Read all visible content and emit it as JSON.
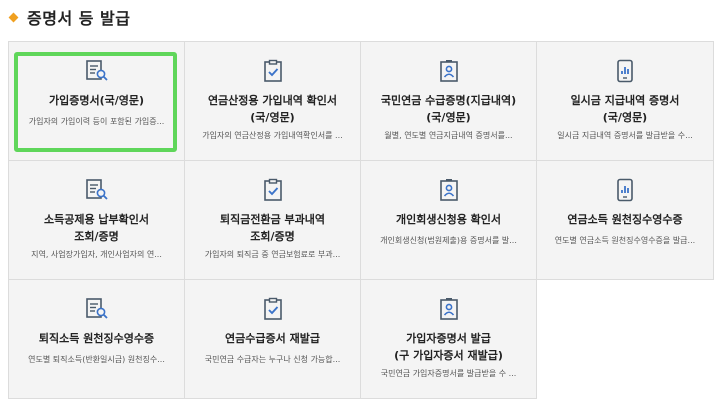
{
  "page": {
    "title": "증명서 등 발급"
  },
  "colors": {
    "accent_diamond": "#f0a020",
    "highlight": "#5fd65a",
    "icon": "#4a5a6a",
    "icon_accent": "#3b73c9"
  },
  "cards": [
    {
      "icon": "document-search-icon",
      "title_lines": [
        "가입증명서(국/영문)"
      ],
      "desc": "가입자의 가입이력 등이 포함된 가입증..."
    },
    {
      "icon": "clipboard-check-icon",
      "title_lines": [
        "연금산정용 가입내역 확인서",
        "(국/영문)"
      ],
      "desc": "가입자의 연금산정용 가입내역확인서를 ..."
    },
    {
      "icon": "id-badge-icon",
      "title_lines": [
        "국민연금 수급증명(지급내역)",
        "(국/영문)"
      ],
      "desc": "월별, 연도별 연금지급내역 증명서를..."
    },
    {
      "icon": "mobile-chart-icon",
      "title_lines": [
        "일시금 지급내역 증명서",
        "(국/영문)"
      ],
      "desc": "일시금 지급내역 증명서를 발급받을 수..."
    },
    {
      "icon": "document-search-icon",
      "title_lines": [
        "소득공제용 납부확인서",
        "조회/증명"
      ],
      "desc": "지역, 사업장가입자, 개인사업자의 연..."
    },
    {
      "icon": "clipboard-check-icon",
      "title_lines": [
        "퇴직금전환금 부과내역",
        "조회/증명"
      ],
      "desc": "가입자의 퇴직금 중 연금보험료로 부과..."
    },
    {
      "icon": "id-badge-icon",
      "title_lines": [
        "개인회생신청용 확인서"
      ],
      "desc": "개인회생신청(법원제출)용 증명서를 발..."
    },
    {
      "icon": "mobile-chart-icon",
      "title_lines": [
        "연금소득 원천징수영수증"
      ],
      "desc": "연도별 연금소득 원천징수영수증을 발급..."
    },
    {
      "icon": "document-search-icon",
      "title_lines": [
        "퇴직소득 원천징수영수증"
      ],
      "desc": "연도별 퇴직소득(반환일시금) 원천징수..."
    },
    {
      "icon": "clipboard-check-icon",
      "title_lines": [
        "연금수급증서 재발급"
      ],
      "desc": "국민연금 수급자는 누구나 신청 가능합..."
    },
    {
      "icon": "id-badge-icon",
      "title_lines": [
        "가입자증명서 발급",
        "(구 가입자증서 재발급)"
      ],
      "desc": "국민연금 가입자증명서를 발급받을 수 ..."
    }
  ]
}
